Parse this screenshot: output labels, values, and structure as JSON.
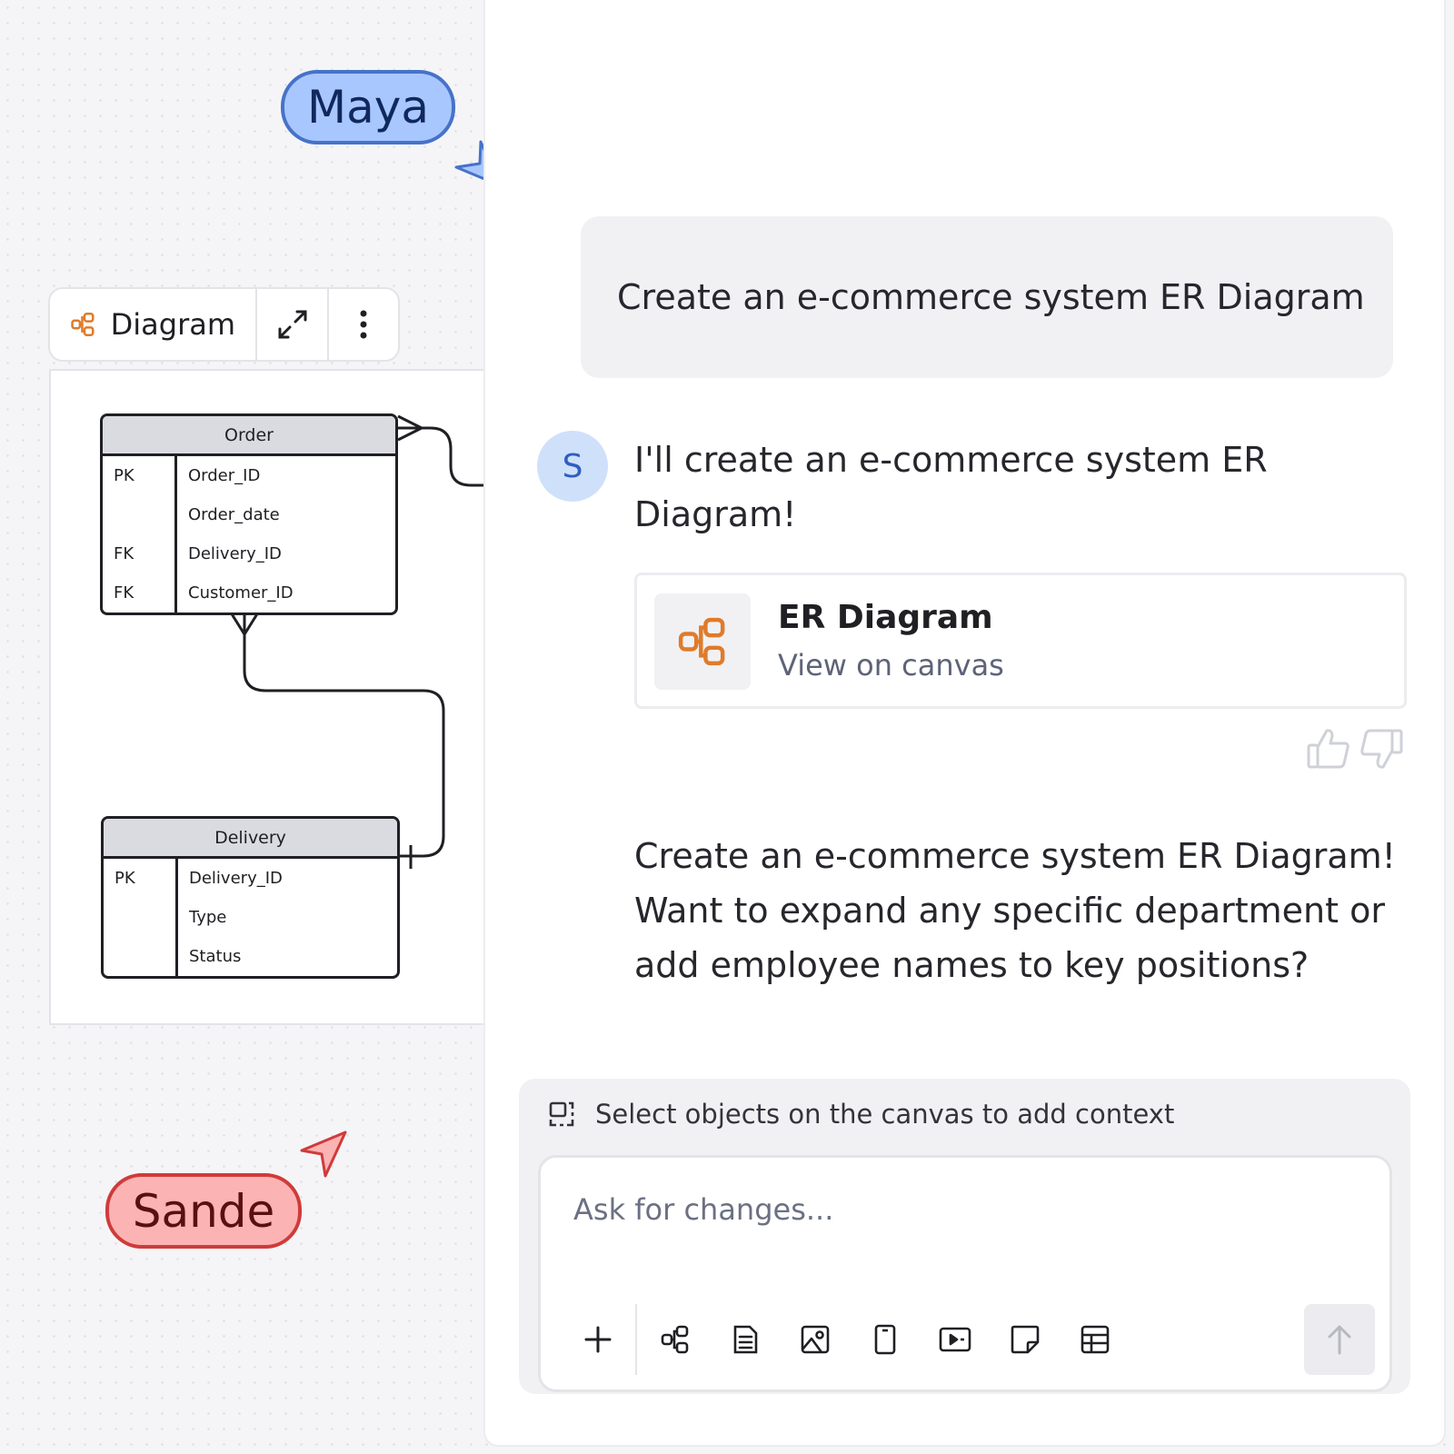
{
  "cursors": {
    "maya": {
      "name": "Maya",
      "color": "#a9c7ff",
      "border": "#4672c9"
    },
    "sande": {
      "name": "Sande",
      "color": "#fcb3b3",
      "border": "#cf3b3b"
    }
  },
  "diagram_toolbar": {
    "label": "Diagram",
    "icon": "diagram-icon",
    "actions": [
      "expand-icon",
      "more-vertical-icon"
    ]
  },
  "er_diagram": {
    "order": {
      "title": "Order",
      "rows": [
        {
          "key": "PK",
          "field": "Order_ID"
        },
        {
          "key": "",
          "field": "Order_date"
        },
        {
          "key": "FK",
          "field": "Delivery_ID"
        },
        {
          "key": "FK",
          "field": "Customer_ID"
        }
      ]
    },
    "delivery": {
      "title": "Delivery",
      "rows": [
        {
          "key": "PK",
          "field": "Delivery_ID"
        },
        {
          "key": "",
          "field": "Type"
        },
        {
          "key": "",
          "field": "Status"
        }
      ]
    }
  },
  "chat": {
    "user_message": "Create an e-commerce system ER Diagram",
    "assistant_avatar": "S",
    "assistant_reply": "I'll create an e-commerce system ER Diagram!",
    "artifact": {
      "title": "ER Diagram",
      "link": "View on canvas",
      "icon": "diagram-icon",
      "accent": "#e07b2a"
    },
    "feedback": [
      "thumbs-up-icon",
      "thumbs-down-icon"
    ],
    "follow_up": "Create an e-commerce system ER Diagram! Want to expand any specific department or add employee names to key positions?"
  },
  "composer": {
    "context_hint": "Select objects on the canvas to add context",
    "placeholder": "Ask for changes...",
    "value": "",
    "tools": [
      "plus-icon",
      "diagram-icon",
      "document-icon",
      "image-icon",
      "mobile-frame-icon",
      "slides-icon",
      "sticky-note-icon",
      "table-icon"
    ],
    "send_icon": "arrow-up-icon"
  }
}
